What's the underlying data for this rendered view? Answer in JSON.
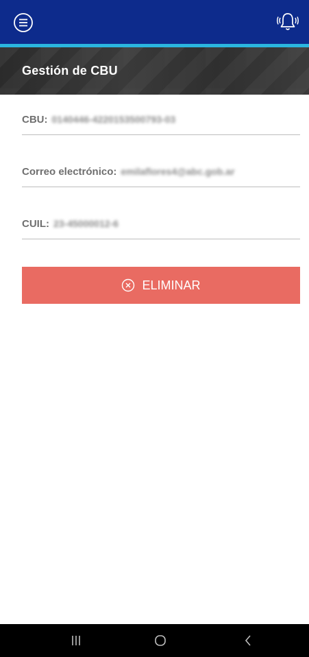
{
  "header": {
    "title": "Gestión de CBU",
    "menu_icon": "menu-circle-icon",
    "notification_icon": "bell-ringing-icon"
  },
  "fields": [
    {
      "label": "CBU:",
      "value": "0140446-4220153500793-03"
    },
    {
      "label": "Correo electrónico:",
      "value": "emilaflores4@abc.gob.ar"
    },
    {
      "label": "CUIL:",
      "value": "23-45000012-6"
    }
  ],
  "delete_button": {
    "label": "ELIMINAR",
    "icon": "close-circle-icon"
  },
  "system_nav": {
    "recents_icon": "recents-icon",
    "home_icon": "home-icon",
    "back_icon": "back-icon"
  },
  "colors": {
    "appbar": "#0d2b8c",
    "accent_line": "#2bb6df",
    "delete": "#e96b62",
    "title_bar": "#333333"
  }
}
